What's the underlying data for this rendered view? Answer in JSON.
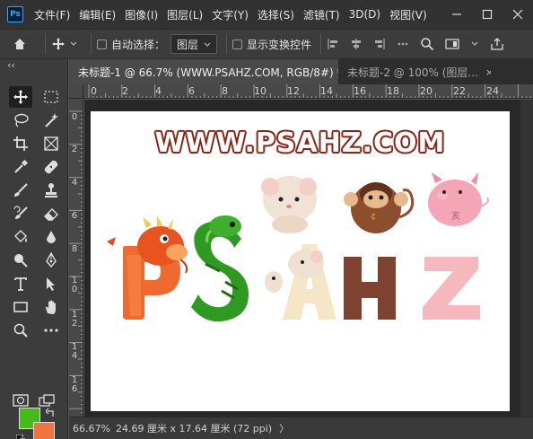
{
  "menubar": {
    "app_icon": "Ps",
    "items": [
      "文件(F)",
      "编辑(E)",
      "图像(I)",
      "图层(L)",
      "文字(Y)",
      "选择(S)",
      "滤镜(T)",
      "3D(D)",
      "视图(V)"
    ],
    "window_buttons": [
      "minimize-icon",
      "maximize-icon",
      "close-icon"
    ]
  },
  "options": {
    "auto_select_label": "自动选择：",
    "auto_select_target": "图层",
    "show_transform_label": "显示变换控件"
  },
  "tabs": [
    {
      "label": "未标题-1 @ 66.7% (WWW.PSAHZ.COM, RGB/8#) *",
      "close": "×"
    },
    {
      "label": "未标题-2 @ 100% (图层...",
      "close": "×"
    }
  ],
  "rulers": {
    "top": [
      "0",
      "2",
      "4",
      "6",
      "8",
      "10",
      "12",
      "14",
      "16",
      "18",
      "20",
      "22",
      "24"
    ],
    "left": [
      "0",
      "2",
      "4",
      "6",
      "8",
      "1 0",
      "1 2",
      "1 4",
      "1 6"
    ]
  },
  "canvas": {
    "headline": "WWW.PSAHZ.COM",
    "letters": [
      {
        "char": "P",
        "color": "#ef6a2e",
        "animal": "dragon"
      },
      {
        "char": "S",
        "color": "#2f9a22",
        "animal": "snake"
      },
      {
        "char": "A",
        "color": "#f6e6c8",
        "animal": "rats"
      },
      {
        "char": "H",
        "color": "#7d4330",
        "animal": "monkey"
      },
      {
        "char": "Z",
        "color": "#f5b9bd",
        "animal": "pig"
      }
    ]
  },
  "colors": {
    "foreground": "#49b81d",
    "background": "#ee7540"
  },
  "status": {
    "zoom": "66.67%",
    "doc_info": "24.69 厘米 x 17.64 厘米 (72 ppi)",
    "arrow": "〉"
  }
}
